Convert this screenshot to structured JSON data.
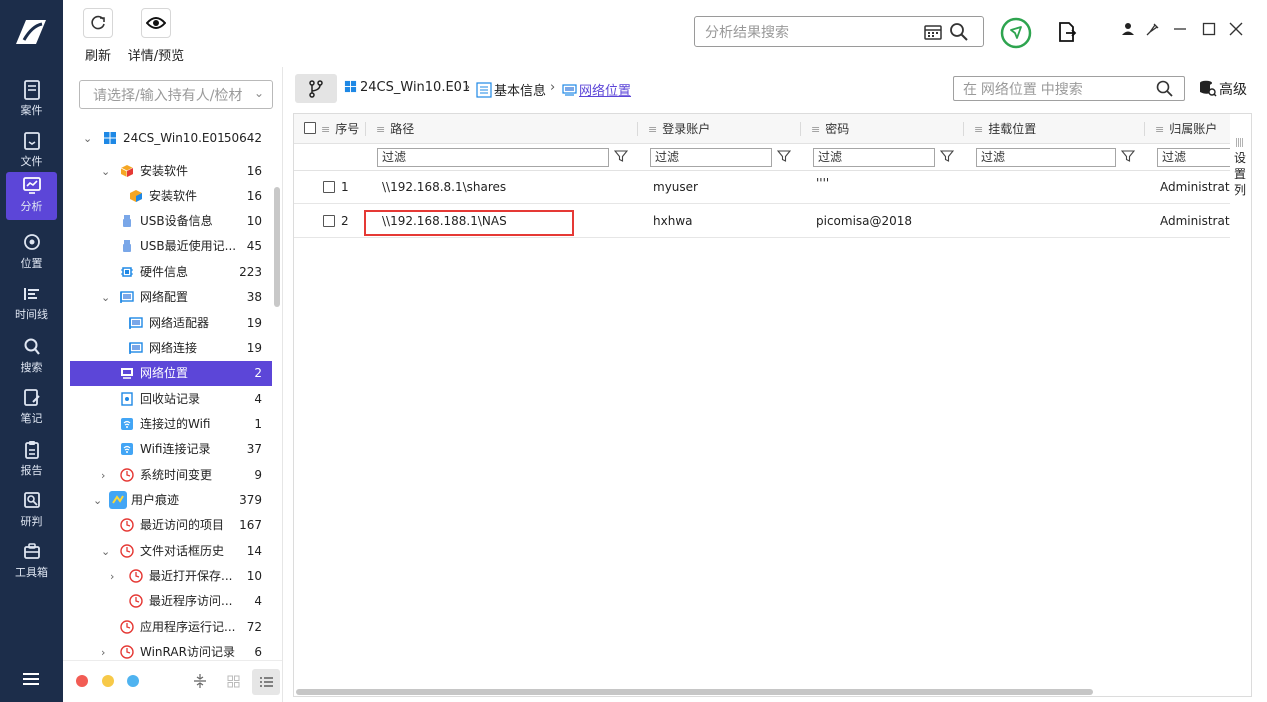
{
  "toolbar": {
    "refresh_label": "刷新",
    "details_label": "详情/预览",
    "search_placeholder": "分析结果搜索"
  },
  "rail": {
    "items": [
      {
        "label": "案件",
        "icon": "case-icon"
      },
      {
        "label": "文件",
        "icon": "file-icon"
      },
      {
        "label": "分析",
        "icon": "analysis-icon"
      },
      {
        "label": "位置",
        "icon": "location-icon"
      },
      {
        "label": "时间线",
        "icon": "timeline-icon"
      },
      {
        "label": "搜索",
        "icon": "search-icon"
      },
      {
        "label": "笔记",
        "icon": "notes-icon"
      },
      {
        "label": "报告",
        "icon": "report-icon"
      },
      {
        "label": "研判",
        "icon": "judge-icon"
      },
      {
        "label": "工具箱",
        "icon": "toolbox-icon"
      }
    ],
    "active": "分析"
  },
  "tree": {
    "select_placeholder": "请选择/输入持有人/检材",
    "items": [
      {
        "label": "24CS_Win10.E01",
        "count": "50642"
      },
      {
        "label": "安装软件",
        "count": "16"
      },
      {
        "label": "安装软件",
        "count": "16"
      },
      {
        "label": "USB设备信息",
        "count": "10"
      },
      {
        "label": "USB最近使用记...",
        "count": "45"
      },
      {
        "label": "硬件信息",
        "count": "223"
      },
      {
        "label": "网络配置",
        "count": "38"
      },
      {
        "label": "网络适配器",
        "count": "19"
      },
      {
        "label": "网络连接",
        "count": "19"
      },
      {
        "label": "网络位置",
        "count": "2"
      },
      {
        "label": "回收站记录",
        "count": "4"
      },
      {
        "label": "连接过的Wifi",
        "count": "1"
      },
      {
        "label": "Wifi连接记录",
        "count": "37"
      },
      {
        "label": "系统时间变更",
        "count": "9"
      },
      {
        "label": "用户痕迹",
        "count": "379"
      },
      {
        "label": "最近访问的项目",
        "count": "167"
      },
      {
        "label": "文件对话框历史",
        "count": "14"
      },
      {
        "label": "最近打开保存...",
        "count": "10"
      },
      {
        "label": "最近程序访问...",
        "count": "4"
      },
      {
        "label": "应用程序运行记...",
        "count": "72"
      },
      {
        "label": "WinRAR访问记录",
        "count": "6"
      }
    ]
  },
  "breadcrumb": {
    "evidence": "24CS_Win10.E01",
    "section": "基本信息",
    "current": "网络位置"
  },
  "content": {
    "search_placeholder": "在 网络位置 中搜索",
    "advanced_label": "高级",
    "settings_col_label": "设置列"
  },
  "table": {
    "headers": [
      "序号",
      "路径",
      "登录账户",
      "密码",
      "挂载位置",
      "归属账户"
    ],
    "filter_placeholder": "过滤",
    "rows": [
      {
        "index": "1",
        "path": "\\\\192.168.8.1\\shares",
        "account": "myuser",
        "password": "''''",
        "mount": "",
        "owner": "Administrator"
      },
      {
        "index": "2",
        "path": "\\\\192.168.188.1\\NAS",
        "account": "hxhwa",
        "password": "picomisa@2018",
        "mount": "",
        "owner": "Administrator"
      }
    ],
    "highlighted_row": 2
  },
  "colors": {
    "rail_bg": "#1c2d4a",
    "accent": "#5c46d8",
    "highlight_box": "#e53935"
  }
}
